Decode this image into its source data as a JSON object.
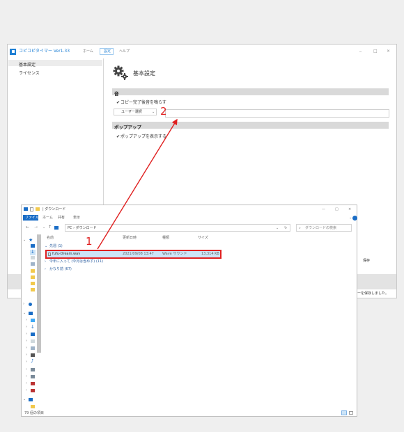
{
  "app": {
    "title": "コピコピタイマー Ver1.33",
    "menu": [
      "ホーム",
      "設定",
      "ヘルプ"
    ],
    "window_controls": [
      "_",
      "□",
      "×"
    ],
    "sidebar": [
      "基本設定",
      "ライセンス"
    ],
    "page_title": "基本設定",
    "section_sound": "音",
    "check_sound": "コピー完了後音を鳴らす",
    "select_value": "ユーザー選択",
    "section_popup": "ポップアップ",
    "check_popup": "ポップアップを表示する",
    "save_button": "保存",
    "status": "ーを保存しました。"
  },
  "annotations": {
    "one": "1",
    "two": "2"
  },
  "explorer": {
    "title": "| ダウンロード",
    "window_controls": [
      "—",
      "□",
      "×"
    ],
    "ribbon_tabs": [
      "ファイル",
      "ホーム",
      "共有",
      "表示"
    ],
    "address": "PC › ダウンロード",
    "search_placeholder": "ダウンロードの検索",
    "columns": [
      "名前",
      "更新日時",
      "種類",
      "サイズ"
    ],
    "group_lastweek": "先週 (1)",
    "file": {
      "name": "fufu-Dream.wav",
      "date": "2021/09/08 13:47",
      "type": "Wave サウンド",
      "size": "13,314 KB"
    },
    "group_month": "今年に入って (今月は含めず) (11)",
    "group_older": "かなり前 (67)",
    "status_count": "79 個の項目"
  },
  "colors": {
    "accent": "#1e7fd4",
    "highlight": "#e02020",
    "file_ribbon": "#1a6dc6"
  }
}
